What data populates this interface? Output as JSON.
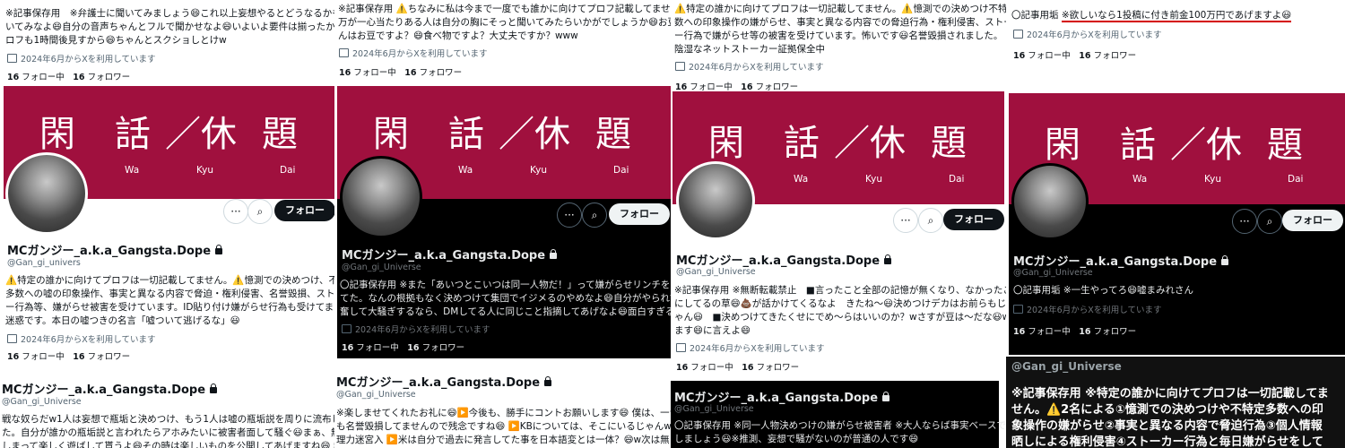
{
  "banner": {
    "kanji": [
      "閑",
      "話",
      "／休",
      "題"
    ],
    "romaji": [
      "Wa",
      "Kyu",
      "Dai"
    ]
  },
  "stats": {
    "following_count": "16",
    "following_label": "フォロー中",
    "followers_count": "16",
    "followers_label": "フォロワー"
  },
  "buttons": {
    "more": "···",
    "search": "⌕",
    "follow": "フォロー"
  },
  "colors": {
    "banner": "#a0103e",
    "dark_bg": "#000000",
    "underline": "#d40000"
  },
  "col1": {
    "top_lines": [
      "※記事保存用　※弁護士に聞いてみましょう😄これ以上妄想やるとどうなるかも聞",
      "いてみなよ😄自分の音声ちゃんとフルで聞かせなよ😄いよいよ要件は揃ったからプ",
      "ロフも1時間後見すから😄ちゃんとスクショしとけw"
    ],
    "joined": "2024年6月からXを利用しています",
    "name": "MCガンジー_a.k.a_Gangsta.Dope",
    "handle": "@Gan_gi_univers",
    "bio": [
      "⚠️特定の誰かに向けてプロフは一切記載してません。⚠️憶測での決めつけ、不特定",
      "多数への嘘の印象操作、事実と異なる内容で脅迫・権利侵害、名誉毀損、ストーカ",
      "ー行為等、嫌がらせ被害を受けています。ID貼り付け嫌がらせ行為も受けてます。",
      "迷惑です。本日の嘘つきの名言「嘘ついて逃げるな」😃"
    ],
    "joined2": "2024年6月からXを利用しています",
    "name2": "MCガンジー_a.k.a_Gangsta.Dope",
    "handle2": "@Gan_gi_Universe",
    "bio2": [
      "戦な奴らだw1人は妄想で瓶垢と決めつけ、もう1人は嘘の瓶垢説を周りに流布し",
      "た。自分が誰かの瓶垢説と言われたらアホみたいに被害者面して騒ぐ😃まぁ、無闇",
      "しまって楽しく遊ばして貰うよ😄その時は楽しいものを公開してあげますね😄 無八"
    ]
  },
  "col2": {
    "top_lines": [
      "※記事保存用 ⚠️ちなみに私は今まで一度でも誰かに向けてプロフ記載してません。",
      "万が一心当たりある人は自分の胸にそっと聞いてみたらいかがでしょうか😄お豆さ",
      "んはお豆ですよ？😄食べ物ですよ？大丈夫ですか？www"
    ],
    "joined": "2024年6月からXを利用しています",
    "name": "MCガンジー_a.k.a_Gangsta.Dope",
    "handle": "@Gan_gi_Universe",
    "bio": [
      "〇記事保存用 ※また「あいつとこいつは同一人物だ！」って嫌がらせリンチをやっ",
      "てた。なんの根拠もなく決めつけて集団でイジメるのやめなよ😄自分がやられて興",
      "奮して大騒ぎするなら、DMしてる人に同じこと指摘してあげなよ😄面白すぎる😄"
    ],
    "joined2": "2024年6月からXを利用しています",
    "name2": "MCガンジー_a.k.a_Gangsta.Dope",
    "handle2": "@Gan_gi_Universe",
    "bio2": [
      "※楽しませてくれたお礼に😄▶️今後も、勝手にコントお願いします😄 僕は、一つ",
      "も名誉毀損してませんので残念ですね😄 ▶️KBについては、そこにいるじゃんw推",
      "理力迷宮入 ▶️米は自分で過去に発言してた事を日本語変とは一体？😄w次は無"
    ]
  },
  "col3": {
    "top_lines": [
      "⚠️特定の誰かに向けてプロフは一切記載してません。⚠️憶測での決めつけ不特定多",
      "数への印象操作の嫌がらせ、事実と異なる内容での脅迫行為・権利侵害、ストーカ",
      "ー行為で嫌がらせ等の被害を受けています。怖いです😃名誉毀損されました。",
      "陰湿なネットストーカー証拠保全中"
    ],
    "joined": "2024年6月からXを利用しています",
    "name": "MCガンジー_a.k.a_Gangsta.Dope",
    "handle": "@Gan_gi_Universe",
    "bio": [
      "※記事保存用 ※無断転載禁止　■言ったこと全部の記憶が無くなり、なかったこと",
      "にしてるの草😄💩が話かけてくるなよ　きたね～😃決めつけデカはお前らもじ",
      "ゃん😃　■決めつけてきたくせにでめ～らはいいのか？wさすが豆は～だな😃w",
      "ます😄に言えよ😄"
    ],
    "joined2": "2024年6月からXを利用しています",
    "name2": "MCガンジー_a.k.a_Gangsta.Dope",
    "handle2": "@Gan_gi_Universe",
    "bio2": [
      "〇記事保存用 ※同一人物決めつけの嫌がらせ被害者 ※大人ならば事実ベースで話",
      "しましょう😃※推測、妄想で騒がないのが普通の人です😄"
    ]
  },
  "col4": {
    "top_line": "〇記事用垢",
    "top_highlight": "※欲しいなら1投稿に付き前金100万円であげますよ😃",
    "joined": "2024年6月からXを利用しています",
    "name": "MCガンジー_a.k.a_Gangsta.Dope",
    "handle": "@Gan_gi_Universe",
    "bio": [
      "〇記事用垢 ※一生やってろ😄嘘まみれさん"
    ],
    "joined2": "2024年6月からXを利用しています",
    "handle2": "@Gan_gi_Universe",
    "bio2": [
      "※記事保存用 ※特定の誰かに向けてプロフは一切記載してま",
      "せん。⚠️2名による①憶測での決めつけや不特定多数への印",
      "象操作の嫌がらせ②事実と異なる内容で脅迫行為③個人情報",
      "晒しによる権利侵害④ストーカー行為と毎日嫌がらせをして"
    ]
  }
}
